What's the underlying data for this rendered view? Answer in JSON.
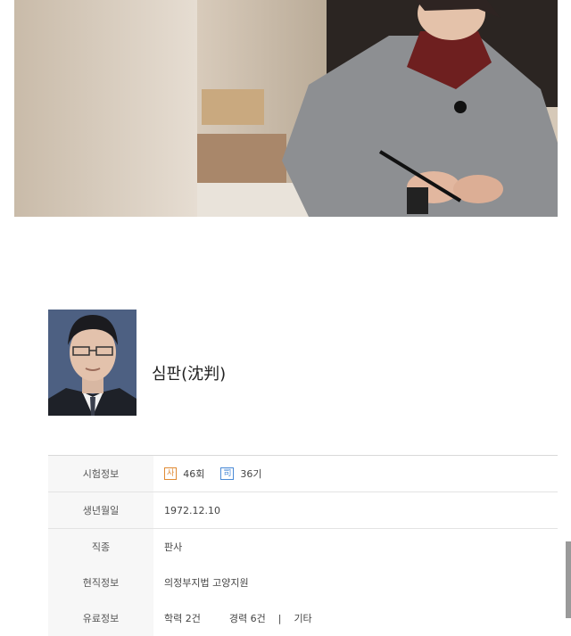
{
  "profile": {
    "name": "심판(沈判)"
  },
  "table": {
    "rows": [
      {
        "label": "시험정보",
        "badge1": "사",
        "value1": "46회",
        "badge2": "司",
        "value2": "36기"
      },
      {
        "label": "생년월일",
        "value": "1972.12.10"
      },
      {
        "label": "직종",
        "value": "판사"
      },
      {
        "label": "현직정보",
        "value": "의정부지법 고양지원"
      },
      {
        "label": "유료정보",
        "item1": "학력 2건",
        "item2": "경력 6건",
        "item3": "기타"
      }
    ]
  },
  "colors": {
    "badge_sa": "#e08a33",
    "badge_gi": "#4a8ad6"
  }
}
